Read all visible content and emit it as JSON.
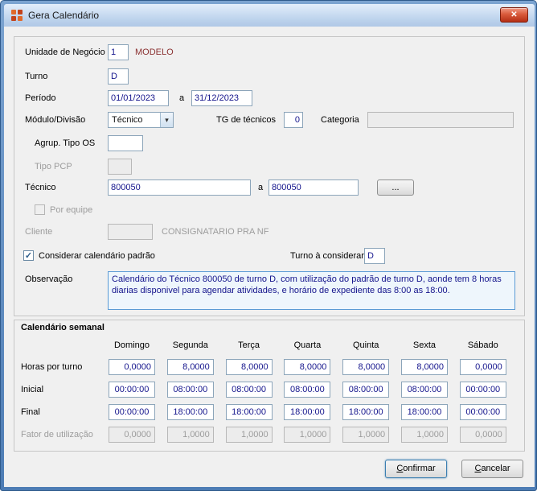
{
  "window": {
    "title": "Gera Calendário"
  },
  "icons": {
    "close": "✕",
    "combo_arrow": "▾",
    "check": "✓",
    "app_icon": "calendar-grid-icon"
  },
  "form": {
    "unidade": {
      "label": "Unidade de Negócio",
      "value": "1",
      "name": "MODELO"
    },
    "turno": {
      "label": "Turno",
      "value": "D"
    },
    "periodo": {
      "label": "Período",
      "start": "01/01/2023",
      "sep": "a",
      "end": "31/12/2023"
    },
    "modulo": {
      "label": "Módulo/Divisão",
      "value": "Técnico"
    },
    "tg": {
      "label": "TG de técnicos",
      "value": "0"
    },
    "categoria": {
      "label": "Categoria",
      "value": ""
    },
    "agrup": {
      "label": "Agrup. Tipo OS",
      "value": ""
    },
    "tipo_pcp": {
      "label": "Tipo PCP",
      "value": ""
    },
    "tecnico": {
      "label": "Técnico",
      "start": "800050",
      "sep": "a",
      "end": "800050",
      "browse": "..."
    },
    "por_equipe": {
      "label": "Por equipe",
      "checked": false
    },
    "cliente": {
      "label": "Cliente",
      "value": "",
      "name": "CONSIGNATARIO PRA NF"
    },
    "considerar": {
      "label": "Considerar calendário padrão",
      "checked": true
    },
    "turno_considerar": {
      "label": "Turno à considerar",
      "value": "D"
    },
    "observacao": {
      "label": "Observação",
      "value": "Calendário do Técnico 800050 de turno D, com utilização do padrão de turno D, aonde tem 8 horas diarias disponivel para agendar atividades, e horário de expediente das 8:00 as 18:00."
    }
  },
  "weekly": {
    "title": "Calendário semanal",
    "days": [
      "Domingo",
      "Segunda",
      "Terça",
      "Quarta",
      "Quinta",
      "Sexta",
      "Sábado"
    ],
    "rows": [
      {
        "label": "Horas por turno",
        "disabled": false,
        "values": [
          "0,0000",
          "8,0000",
          "8,0000",
          "8,0000",
          "8,0000",
          "8,0000",
          "0,0000"
        ]
      },
      {
        "label": "Inicial",
        "disabled": false,
        "values": [
          "00:00:00",
          "08:00:00",
          "08:00:00",
          "08:00:00",
          "08:00:00",
          "08:00:00",
          "00:00:00"
        ]
      },
      {
        "label": "Final",
        "disabled": false,
        "values": [
          "00:00:00",
          "18:00:00",
          "18:00:00",
          "18:00:00",
          "18:00:00",
          "18:00:00",
          "00:00:00"
        ]
      },
      {
        "label": "Fator de utilização",
        "disabled": true,
        "values": [
          "0,0000",
          "1,0000",
          "1,0000",
          "1,0000",
          "1,0000",
          "1,0000",
          "0,0000"
        ]
      }
    ]
  },
  "buttons": {
    "confirm": "Confirmar",
    "cancel": "Cancelar"
  },
  "colors": {
    "value_text": "#14148c",
    "modelo_text": "#8b3232",
    "muted_text": "#9c9c9c",
    "frame_blue": "#4d7cb4",
    "observacao_border": "#5b9bd5"
  }
}
